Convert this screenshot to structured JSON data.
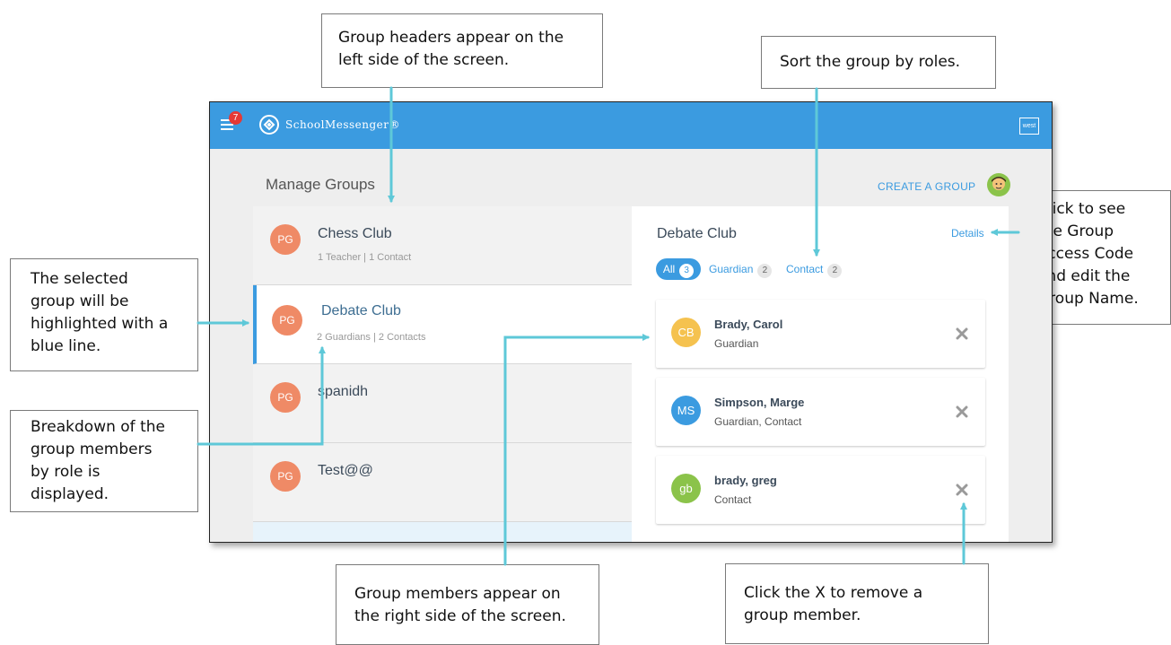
{
  "callouts": {
    "headers": "Group headers appear on the\nleft side of the screen.",
    "sort": "Sort the group by roles.",
    "selected": "The selected\ngroup will be\nhighlighted with a\nblue line.",
    "breakdown": "Breakdown of the\ngroup members\nby role is\ndisplayed.",
    "details": "Click to see\nthe Group\nAccess Code\nand edit the\nGroup Name.",
    "members": "Group members appear on\nthe right side of the screen.",
    "remove": "Click the X to remove a\ngroup member."
  },
  "header": {
    "notifications": "7",
    "brand": "SchoolMessenger®",
    "user_chip": "west"
  },
  "page": {
    "title": "Manage Groups",
    "create_group": "CREATE A GROUP"
  },
  "groups": [
    {
      "initials": "PG",
      "name": "Chess Club",
      "subtitle": "1 Teacher | 1 Contact"
    },
    {
      "initials": "PG",
      "name": "Debate Club",
      "subtitle": "2 Guardians | 2 Contacts",
      "selected": true
    },
    {
      "initials": "PG",
      "name": "spanidh",
      "subtitle": ""
    },
    {
      "initials": "PG",
      "name": "Test@@",
      "subtitle": ""
    }
  ],
  "detail": {
    "title": "Debate Club",
    "details_link": "Details",
    "filters": [
      {
        "label": "All",
        "count": "3",
        "active": true
      },
      {
        "label": "Guardian",
        "count": "2"
      },
      {
        "label": "Contact",
        "count": "2"
      }
    ],
    "members": [
      {
        "initials": "CB",
        "name": "Brady, Carol",
        "role": "Guardian",
        "color": "#f5c24f"
      },
      {
        "initials": "MS",
        "name": "Simpson, Marge",
        "role": "Guardian, Contact",
        "color": "#3b9be0"
      },
      {
        "initials": "gb",
        "name": "brady, greg",
        "role": "Contact",
        "color": "#8bc34a"
      }
    ]
  },
  "colors": {
    "accent": "#3b9be0",
    "avatar_pg": "#ef8a66",
    "arrow": "#5ec8d8",
    "badge": "#e53935"
  }
}
